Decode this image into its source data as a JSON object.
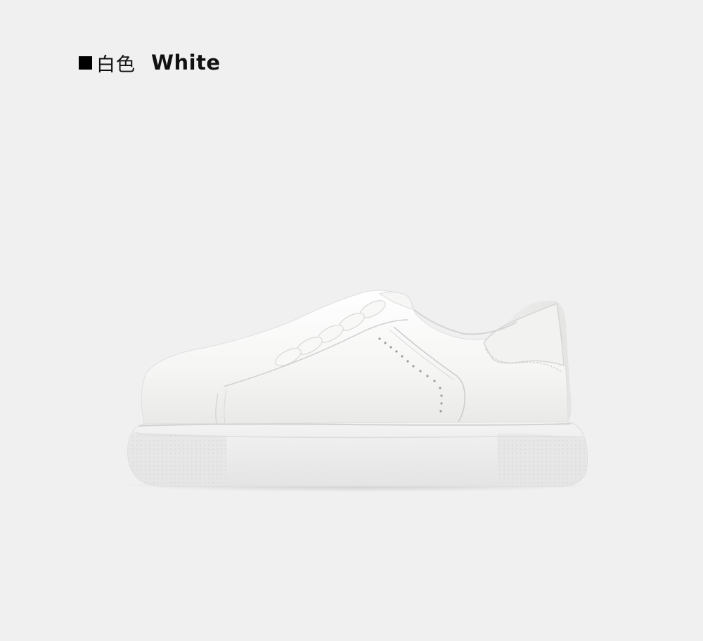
{
  "color_option": {
    "name_cn": "白色",
    "name_en": "White",
    "swatch_color": "#000000"
  },
  "product": {
    "image": "white-low-top-sneaker-side-view",
    "colors": {
      "background": "#f0f0f0",
      "upper": "#f4f4f2",
      "sole": "#ededed"
    }
  }
}
